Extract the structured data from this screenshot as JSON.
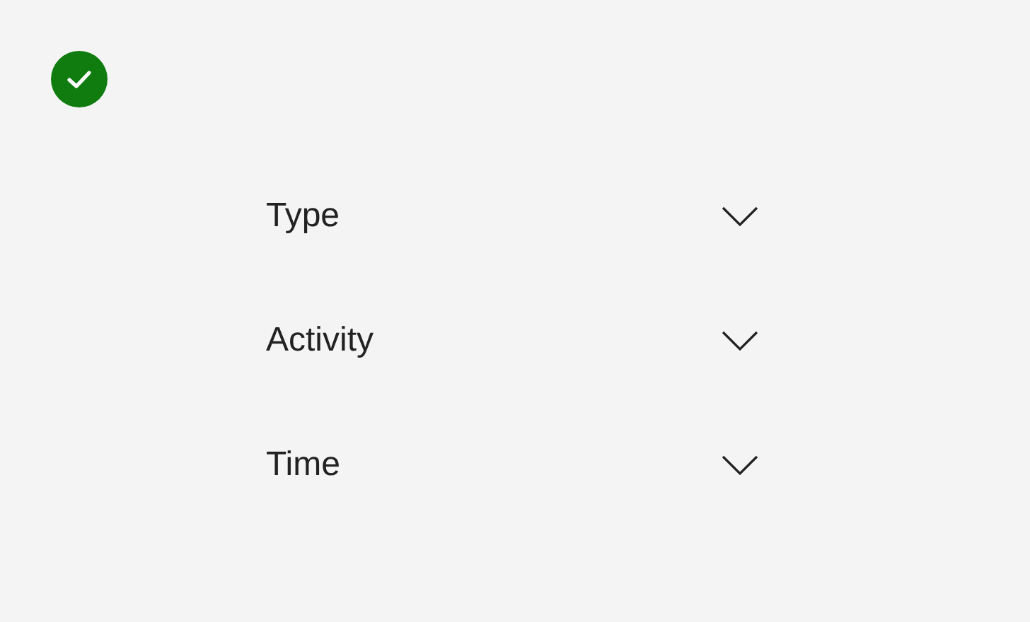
{
  "status": {
    "kind": "success"
  },
  "filters": [
    {
      "label": "Type",
      "expanded": false
    },
    {
      "label": "Activity",
      "expanded": false
    },
    {
      "label": "Time",
      "expanded": false
    }
  ]
}
